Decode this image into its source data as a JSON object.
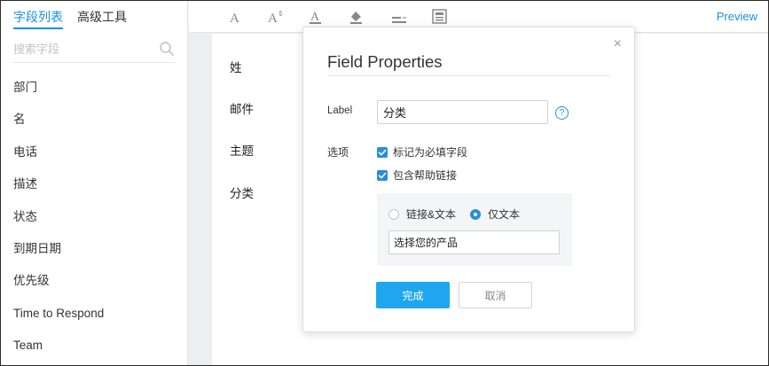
{
  "sidebar": {
    "tabs": [
      {
        "label": "字段列表",
        "active": true
      },
      {
        "label": "高级工具",
        "active": false
      }
    ],
    "search": {
      "placeholder": "搜索字段",
      "icon": "search-icon"
    },
    "fields": [
      "部门",
      "名",
      "电话",
      "描述",
      "状态",
      "到期日期",
      "优先级",
      "Time to Respond",
      "Team"
    ]
  },
  "toolbar": {
    "icons": [
      "font-icon",
      "font-size-icon",
      "text-color-icon",
      "fill-color-icon",
      "label-align-icon",
      "layout-icon"
    ],
    "preview_label": "Preview"
  },
  "canvas": {
    "fields": [
      "姓",
      "邮件",
      "主题",
      "分类"
    ]
  },
  "dialog": {
    "title": "Field Properties",
    "close_symbol": "×",
    "label_caption": "Label",
    "label_value": "分类",
    "help_symbol": "?",
    "options_caption": "选项",
    "checkboxes": [
      {
        "label": "标记为必填字段",
        "checked": true
      },
      {
        "label": "包含帮助链接",
        "checked": true
      }
    ],
    "radios": [
      {
        "label": "链接&文本",
        "selected": false
      },
      {
        "label": "仅文本",
        "selected": true
      }
    ],
    "help_text_value": "选择您的产品",
    "done_label": "完成",
    "cancel_label": "取消"
  },
  "colors": {
    "accent": "#1a8fe3",
    "primary_button": "#1ea7ef",
    "checkbox": "#2a8dd6",
    "sidebar_bg": "#ffffff",
    "main_bg": "#eceef0"
  }
}
